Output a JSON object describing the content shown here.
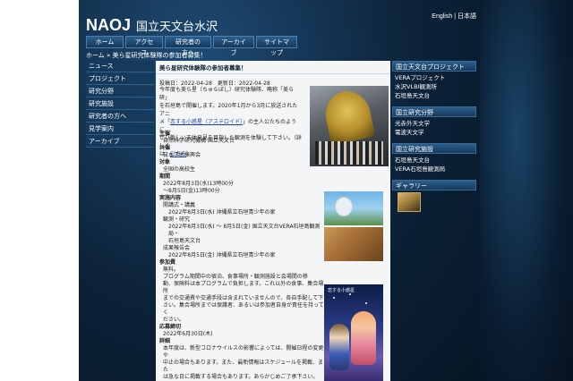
{
  "header": {
    "logo_mark": "NAOJ",
    "logo_text": "国立天文台水沢",
    "lang_english": "English",
    "lang_sep": "|",
    "lang_japanese": "日本語"
  },
  "nav": [
    "ホーム",
    "アクセス",
    "研究者の方へ",
    "アーカイブ",
    "サイトマップ"
  ],
  "breadcrumb": "ホーム » 美ら星研究体験隊の参加者募集！",
  "sidebar": [
    "ニュース",
    "プロジェクト",
    "研究分野",
    "研究施設",
    "研究者の方へ",
    "見学案内",
    "アーカイブ"
  ],
  "article": {
    "title": "美ら星研究体験隊の参加者募集！",
    "dates": "投稿日：2022-04-28　更新日：2022-04-28",
    "intro": [
      "今年度も美ら星（ちゅらぼし）研究体験隊、略称「美ら研」",
      "を石垣島で開催します。2020年1月から3月に放送されたアニ",
      "メ「",
      "恋する小惑星（アステロイド）",
      "」の主人公たちのように、",
      "ぜひ新しい天体発見を目指した観測を体験して下さい。（詳しく",
      "は、",
      "こちら",
      "）"
    ],
    "sections": [
      {
        "label": "主催",
        "lines": [
          "自然科学研究機構 国立天文台"
        ]
      },
      {
        "label": "共催",
        "lines": [
          "日本学術振興会"
        ]
      },
      {
        "label": "対象",
        "lines": [
          "全国の高校生"
        ]
      },
      {
        "label": "期間",
        "lines": [
          "2022年8月3日(水)13時00分",
          "～8月5日(金)13時00分"
        ]
      }
    ],
    "program_label": "実施内容",
    "program": [
      {
        "label": "開講式・講義",
        "lines": [
          "2022年8月3日(水) 沖縄県立石垣青少年の家"
        ]
      },
      {
        "label": "観測・研究",
        "lines": [
          "2022年8月3日(水) ～ 8月5日(金) 国立天文台VERA石垣島観測局・",
          "石垣島天文台"
        ]
      },
      {
        "label": "成果報告会",
        "lines": [
          "2022年8月5日(金) 沖縄県立石垣青少年の家"
        ]
      }
    ],
    "fee_label": "参加費",
    "fee_sub": "無料。",
    "fee_lines": [
      "プログラム期間中の宿泊、食事場所・観測施設と会場間の移",
      "動、保険料は本プログラムで負担します。これ以外の食事、集合場所",
      "までの交通費や交通手段は含まれていませんので、各自手配して下",
      "さい。集合場所までは保護者、あるいは参加者自身が責任を持ってく",
      "ださい。"
    ],
    "deadline_label": "応募締切",
    "deadline": "2022年6月30日(木)",
    "detail_label": "詳細",
    "detail_lines": [
      "本年度は、新型コロナウイルスの影響によっては、開催日程の変更や",
      "中止の場合もあります。また、最新情報はスケジュールを掲載、また",
      "は急な日に掲載する場合もあります。あらかじめご了承下さい。"
    ],
    "poster_caption": "恋する小惑星"
  },
  "right_sidebar": {
    "projects_title": "国立天文台プロジェクト",
    "projects": [
      "VERAプロジェクト",
      "水沢VLBI観測所",
      "石垣島天文台"
    ],
    "fields_title": "国立研究分野",
    "fields": [
      "光赤外天文学",
      "電波天文学"
    ],
    "facilities_title": "国立研究施設",
    "facilities": [
      "石垣島天文台",
      "VERA石垣島観測局"
    ],
    "gallery_title": "ギャラリー"
  }
}
